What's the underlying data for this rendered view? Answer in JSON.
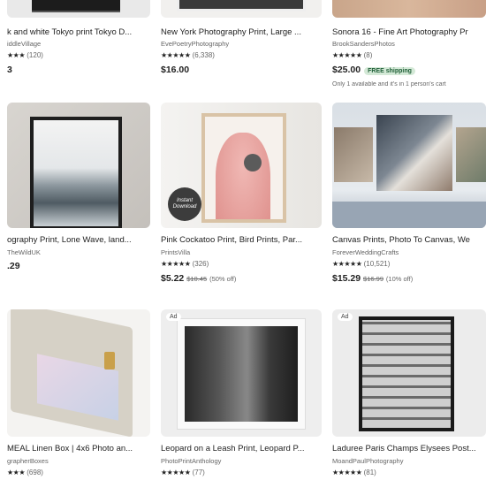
{
  "top_row": [
    {
      "title": "k and white Tokyo print Tokyo D...",
      "shop": "iddleVillage",
      "stars": "★★★",
      "review_count": "(120)",
      "price": "3"
    },
    {
      "title": "New York Photography Print, Large ...",
      "shop": "EvePoetryPhotography",
      "stars": "★★★★★",
      "review_count": "(6,338)",
      "price": "$16.00"
    },
    {
      "title": "Sonora 16 - Fine Art Photography Pr",
      "shop": "BrookSandersPhotos",
      "stars": "★★★★★",
      "review_count": "(8)",
      "price": "$25.00",
      "badge": "FREE shipping",
      "note": "Only 1 available and it's in 1 person's cart"
    }
  ],
  "middle_row": [
    {
      "title": "ography Print, Lone Wave, land...",
      "shop": "TheWildUK",
      "price": ".29"
    },
    {
      "title": "Pink Cockatoo Print, Bird Prints, Par...",
      "shop": "PrintsVilla",
      "stars": "★★★★★",
      "review_count": "(326)",
      "price": "$5.22",
      "original_price": "$10.45",
      "discount": "(50% off)",
      "sticker": "Instant Download"
    },
    {
      "title": "Canvas Prints, Photo To Canvas, We",
      "shop": "ForeverWeddingCrafts",
      "stars": "★★★★★",
      "review_count": "(10,521)",
      "price": "$15.29",
      "original_price": "$16.99",
      "discount": "(10% off)"
    }
  ],
  "bottom_row": [
    {
      "title": "MEAL Linen Box | 4x6 Photo an...",
      "shop": "grapherBoxes",
      "stars": "★★★",
      "review_count": "(698)"
    },
    {
      "ad": "Ad",
      "title": "Leopard on a Leash Print, Leopard P...",
      "shop": "PhotoPrintAnthology",
      "stars": "★★★★★",
      "review_count": "(77)"
    },
    {
      "ad": "Ad",
      "title": "Laduree Paris Champs Elysees Post...",
      "shop": "MoandPaulPhotography",
      "stars": "★★★★★",
      "review_count": "(81)"
    }
  ]
}
